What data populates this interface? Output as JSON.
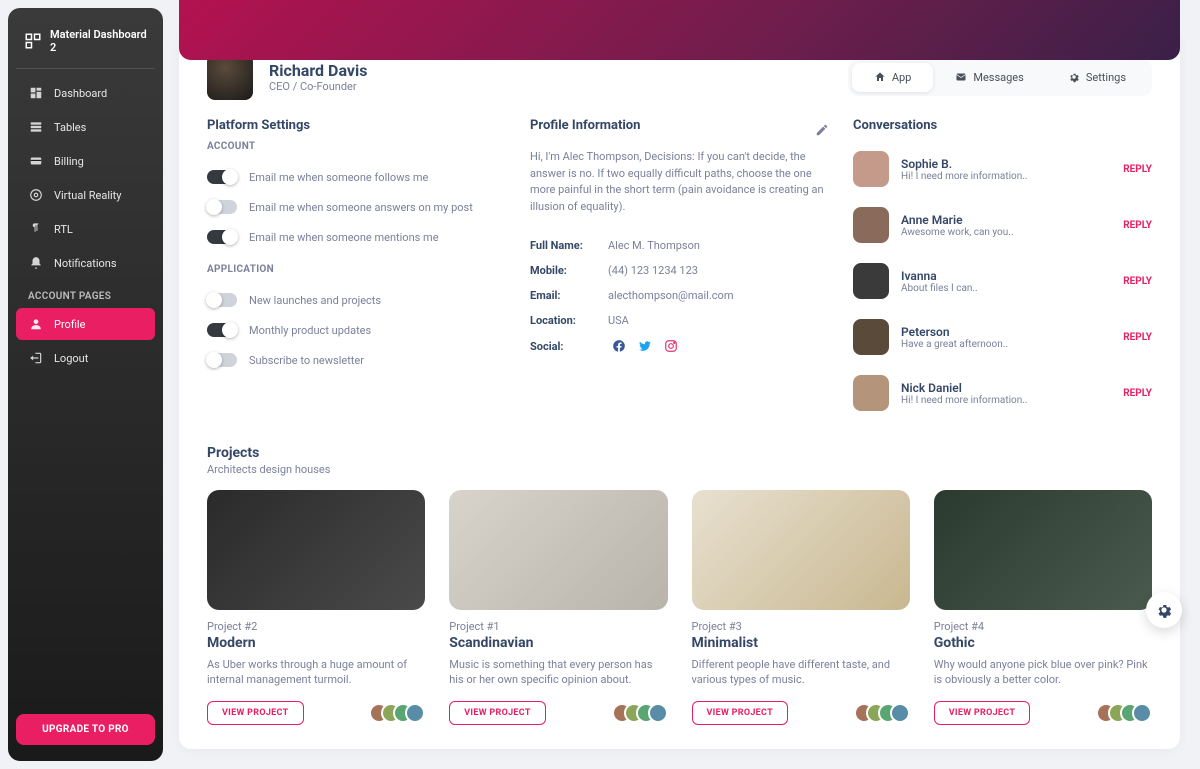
{
  "brand": "Material Dashboard 2",
  "sidebar": {
    "items": [
      {
        "label": "Dashboard",
        "icon": "dashboard"
      },
      {
        "label": "Tables",
        "icon": "tables"
      },
      {
        "label": "Billing",
        "icon": "billing"
      },
      {
        "label": "Virtual Reality",
        "icon": "vr"
      },
      {
        "label": "RTL",
        "icon": "rtl"
      },
      {
        "label": "Notifications",
        "icon": "bell"
      }
    ],
    "section_label": "ACCOUNT PAGES",
    "account_items": [
      {
        "label": "Profile",
        "icon": "person",
        "active": true
      },
      {
        "label": "Logout",
        "icon": "logout"
      }
    ],
    "upgrade_label": "UPGRADE TO PRO"
  },
  "profile": {
    "name": "Richard Davis",
    "role": "CEO / Co-Founder",
    "tabs": [
      {
        "label": "App",
        "icon": "home",
        "active": true
      },
      {
        "label": "Messages",
        "icon": "mail"
      },
      {
        "label": "Settings",
        "icon": "gear"
      }
    ]
  },
  "settings": {
    "title": "Platform Settings",
    "account_label": "ACCOUNT",
    "account_toggles": [
      {
        "label": "Email me when someone follows me",
        "on": true
      },
      {
        "label": "Email me when someone answers on my post",
        "on": false
      },
      {
        "label": "Email me when someone mentions me",
        "on": true
      }
    ],
    "app_label": "APPLICATION",
    "app_toggles": [
      {
        "label": "New launches and projects",
        "on": false
      },
      {
        "label": "Monthly product updates",
        "on": true
      },
      {
        "label": "Subscribe to newsletter",
        "on": false
      }
    ]
  },
  "info": {
    "title": "Profile Information",
    "description": "Hi, I'm Alec Thompson, Decisions: If you can't decide, the answer is no. If two equally difficult paths, choose the one more painful in the short term (pain avoidance is creating an illusion of equality).",
    "rows": {
      "full_name_label": "Full Name:",
      "full_name": "Alec M. Thompson",
      "mobile_label": "Mobile:",
      "mobile": "(44) 123 1234 123",
      "email_label": "Email:",
      "email": "alecthompson@mail.com",
      "location_label": "Location:",
      "location": "USA",
      "social_label": "Social:"
    }
  },
  "conversations": {
    "title": "Conversations",
    "reply_label": "REPLY",
    "items": [
      {
        "name": "Sophie B.",
        "sub": "Hi! I need more information.."
      },
      {
        "name": "Anne Marie",
        "sub": "Awesome work, can you.."
      },
      {
        "name": "Ivanna",
        "sub": "About files I can.."
      },
      {
        "name": "Peterson",
        "sub": "Have a great afternoon.."
      },
      {
        "name": "Nick Daniel",
        "sub": "Hi! I need more information.."
      }
    ]
  },
  "projects_section": {
    "title": "Projects",
    "subtitle": "Architects design houses",
    "view_label": "VIEW PROJECT",
    "items": [
      {
        "tag": "Project #2",
        "name": "Modern",
        "desc": "As Uber works through a huge amount of internal management turmoil.",
        "bg": "linear-gradient(135deg,#2a2a2a,#4a4a4a)"
      },
      {
        "tag": "Project #1",
        "name": "Scandinavian",
        "desc": "Music is something that every person has his or her own specific opinion about.",
        "bg": "linear-gradient(135deg,#d8d4cc,#b8b4ac)"
      },
      {
        "tag": "Project #3",
        "name": "Minimalist",
        "desc": "Different people have different taste, and various types of music.",
        "bg": "linear-gradient(135deg,#e8e0d0,#c8b890)"
      },
      {
        "tag": "Project #4",
        "name": "Gothic",
        "desc": "Why would anyone pick blue over pink? Pink is obviously a better color.",
        "bg": "linear-gradient(135deg,#2a3a2e,#4a5a4e)"
      }
    ]
  },
  "colors": {
    "accent": "#e91e63"
  }
}
